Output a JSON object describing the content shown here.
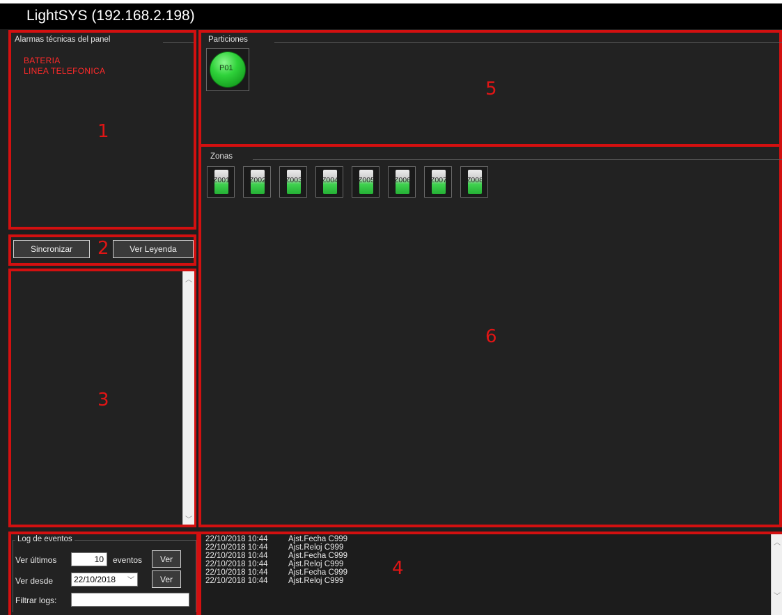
{
  "window": {
    "title": "LightSYS (192.168.2.198)"
  },
  "alarms": {
    "group_label": "Alarmas técnicas del panel",
    "items": [
      "BATERIA",
      "LINEA TELEFONICA"
    ],
    "marker": "1"
  },
  "controls": {
    "sync_label": "Sincronizar",
    "legend_label": "Ver Leyenda",
    "marker": "2"
  },
  "list_panel": {
    "marker": "3"
  },
  "partitions": {
    "group_label": "Particiones",
    "items": [
      {
        "label": "P01",
        "status_color": "#2ecc40"
      }
    ],
    "marker": "5"
  },
  "zones": {
    "group_label": "Zonas",
    "items": [
      "Z001",
      "Z002",
      "Z003",
      "Z004",
      "Z005",
      "Z006",
      "Z007",
      "Z008"
    ],
    "marker": "6"
  },
  "event_log": {
    "group_label": "Log de eventos",
    "ver_ultimos_label": "Ver últimos",
    "count_value": "10",
    "eventos_label": "eventos",
    "ver_button": "Ver",
    "ver_desde_label": "Ver desde",
    "date_value": "22/10/2018",
    "ver_button_2": "Ver",
    "filter_label": "Filtrar logs:",
    "filter_value": "",
    "entries": [
      {
        "time": "22/10/2018 10:44",
        "event": "Ajst.Fecha C999"
      },
      {
        "time": "22/10/2018 10:44",
        "event": "Ajst.Reloj C999"
      },
      {
        "time": "22/10/2018 10:44",
        "event": "Ajst.Fecha C999"
      },
      {
        "time": "22/10/2018 10:44",
        "event": "Ajst.Reloj C999"
      },
      {
        "time": "22/10/2018 10:44",
        "event": "Ajst.Fecha C999"
      },
      {
        "time": "22/10/2018 10:44",
        "event": "Ajst.Reloj C999"
      }
    ],
    "marker": "4"
  },
  "colors": {
    "highlight": "#d31010",
    "alarm_text": "#ff2a2a",
    "background": "#1e1e1e"
  }
}
